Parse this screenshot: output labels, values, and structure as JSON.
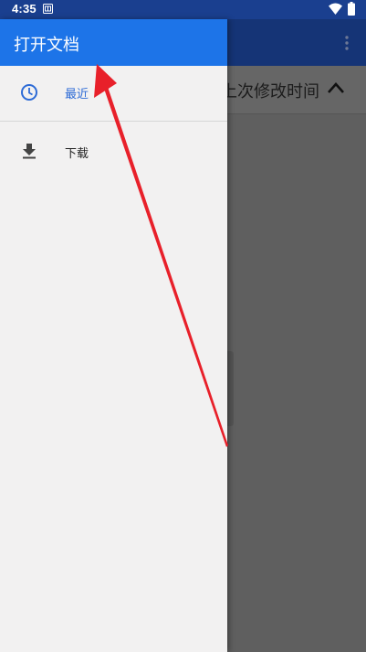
{
  "status_bar": {
    "time": "4:35",
    "notification_icon": "sim-card-icon",
    "wifi_icon": "wifi-icon",
    "battery_icon": "battery-icon"
  },
  "drawer": {
    "title": "打开文档",
    "items": [
      {
        "label": "最近",
        "icon": "clock-icon",
        "selected": true
      },
      {
        "label": "下载",
        "icon": "download-icon",
        "selected": false
      }
    ]
  },
  "underlying_app": {
    "sort_label": "上次修改时间",
    "sort_icon": "chevron-up-icon",
    "overflow_icon": "more-vertical-icon"
  },
  "colors": {
    "header_blue": "#1d74e8",
    "status_bar": "#1a3f8f",
    "selected_item": "#2d6bd6",
    "annotation_arrow": "#e8202a",
    "scrim": "#5f5f5f"
  }
}
